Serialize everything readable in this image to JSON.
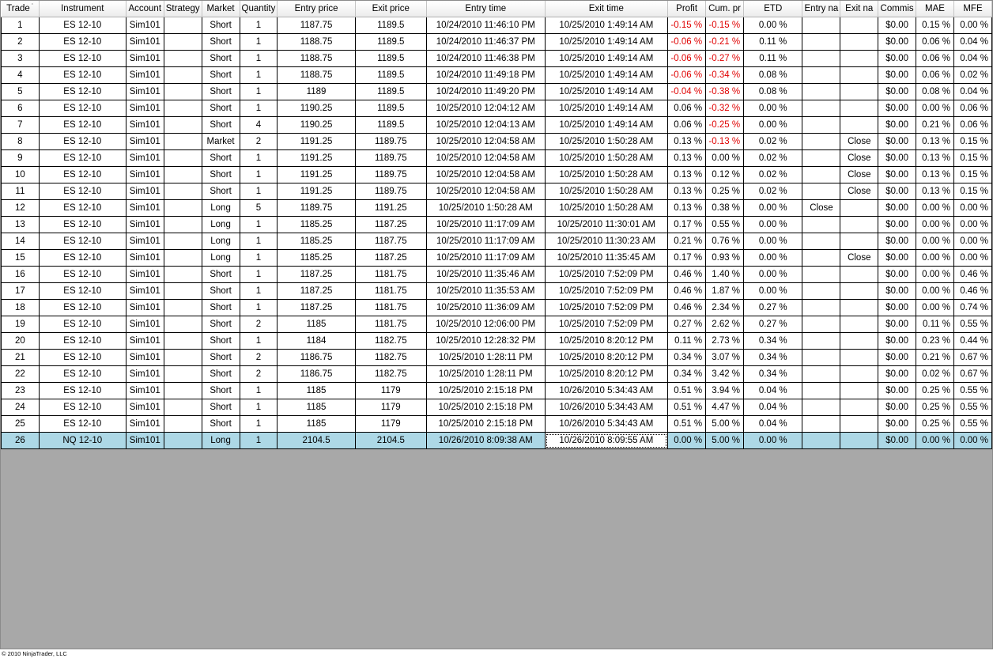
{
  "columns": [
    {
      "label": "Trade"
    },
    {
      "label": "Instrument"
    },
    {
      "label": "Account"
    },
    {
      "label": "Strategy"
    },
    {
      "label": "Market"
    },
    {
      "label": "Quantity"
    },
    {
      "label": "Entry price"
    },
    {
      "label": "Exit price"
    },
    {
      "label": "Entry time"
    },
    {
      "label": "Exit time"
    },
    {
      "label": "Profit"
    },
    {
      "label": "Cum. pr"
    },
    {
      "label": "ETD"
    },
    {
      "label": "Entry na"
    },
    {
      "label": "Exit na"
    },
    {
      "label": "Commis"
    },
    {
      "label": "MAE"
    },
    {
      "label": "MFE"
    }
  ],
  "sort_indicator": "ˆ",
  "rows": [
    [
      "1",
      "ES 12-10",
      "Sim101",
      "",
      "Short",
      "1",
      "1187.75",
      "1189.5",
      "10/24/2010 11:46:10 PM",
      "10/25/2010 1:49:14 AM",
      "-0.15 %",
      "-0.15 %",
      "0.00 %",
      "",
      "",
      "$0.00",
      "0.15 %",
      "0.00 %"
    ],
    [
      "2",
      "ES 12-10",
      "Sim101",
      "",
      "Short",
      "1",
      "1188.75",
      "1189.5",
      "10/24/2010 11:46:37 PM",
      "10/25/2010 1:49:14 AM",
      "-0.06 %",
      "-0.21 %",
      "0.11 %",
      "",
      "",
      "$0.00",
      "0.06 %",
      "0.04 %"
    ],
    [
      "3",
      "ES 12-10",
      "Sim101",
      "",
      "Short",
      "1",
      "1188.75",
      "1189.5",
      "10/24/2010 11:46:38 PM",
      "10/25/2010 1:49:14 AM",
      "-0.06 %",
      "-0.27 %",
      "0.11 %",
      "",
      "",
      "$0.00",
      "0.06 %",
      "0.04 %"
    ],
    [
      "4",
      "ES 12-10",
      "Sim101",
      "",
      "Short",
      "1",
      "1188.75",
      "1189.5",
      "10/24/2010 11:49:18 PM",
      "10/25/2010 1:49:14 AM",
      "-0.06 %",
      "-0.34 %",
      "0.08 %",
      "",
      "",
      "$0.00",
      "0.06 %",
      "0.02 %"
    ],
    [
      "5",
      "ES 12-10",
      "Sim101",
      "",
      "Short",
      "1",
      "1189",
      "1189.5",
      "10/24/2010 11:49:20 PM",
      "10/25/2010 1:49:14 AM",
      "-0.04 %",
      "-0.38 %",
      "0.08 %",
      "",
      "",
      "$0.00",
      "0.08 %",
      "0.04 %"
    ],
    [
      "6",
      "ES 12-10",
      "Sim101",
      "",
      "Short",
      "1",
      "1190.25",
      "1189.5",
      "10/25/2010 12:04:12 AM",
      "10/25/2010 1:49:14 AM",
      "0.06 %",
      "-0.32 %",
      "0.00 %",
      "",
      "",
      "$0.00",
      "0.00 %",
      "0.06 %"
    ],
    [
      "7",
      "ES 12-10",
      "Sim101",
      "",
      "Short",
      "4",
      "1190.25",
      "1189.5",
      "10/25/2010 12:04:13 AM",
      "10/25/2010 1:49:14 AM",
      "0.06 %",
      "-0.25 %",
      "0.00 %",
      "",
      "",
      "$0.00",
      "0.21 %",
      "0.06 %"
    ],
    [
      "8",
      "ES 12-10",
      "Sim101",
      "",
      "Market",
      "2",
      "1191.25",
      "1189.75",
      "10/25/2010 12:04:58 AM",
      "10/25/2010 1:50:28 AM",
      "0.13 %",
      "-0.13 %",
      "0.02 %",
      "",
      "Close",
      "$0.00",
      "0.13 %",
      "0.15 %"
    ],
    [
      "9",
      "ES 12-10",
      "Sim101",
      "",
      "Short",
      "1",
      "1191.25",
      "1189.75",
      "10/25/2010 12:04:58 AM",
      "10/25/2010 1:50:28 AM",
      "0.13 %",
      "0.00 %",
      "0.02 %",
      "",
      "Close",
      "$0.00",
      "0.13 %",
      "0.15 %"
    ],
    [
      "10",
      "ES 12-10",
      "Sim101",
      "",
      "Short",
      "1",
      "1191.25",
      "1189.75",
      "10/25/2010 12:04:58 AM",
      "10/25/2010 1:50:28 AM",
      "0.13 %",
      "0.12 %",
      "0.02 %",
      "",
      "Close",
      "$0.00",
      "0.13 %",
      "0.15 %"
    ],
    [
      "11",
      "ES 12-10",
      "Sim101",
      "",
      "Short",
      "1",
      "1191.25",
      "1189.75",
      "10/25/2010 12:04:58 AM",
      "10/25/2010 1:50:28 AM",
      "0.13 %",
      "0.25 %",
      "0.02 %",
      "",
      "Close",
      "$0.00",
      "0.13 %",
      "0.15 %"
    ],
    [
      "12",
      "ES 12-10",
      "Sim101",
      "",
      "Long",
      "5",
      "1189.75",
      "1191.25",
      "10/25/2010 1:50:28 AM",
      "10/25/2010 1:50:28 AM",
      "0.13 %",
      "0.38 %",
      "0.00 %",
      "Close",
      "",
      "$0.00",
      "0.00 %",
      "0.00 %"
    ],
    [
      "13",
      "ES 12-10",
      "Sim101",
      "",
      "Long",
      "1",
      "1185.25",
      "1187.25",
      "10/25/2010 11:17:09 AM",
      "10/25/2010 11:30:01 AM",
      "0.17 %",
      "0.55 %",
      "0.00 %",
      "",
      "",
      "$0.00",
      "0.00 %",
      "0.00 %"
    ],
    [
      "14",
      "ES 12-10",
      "Sim101",
      "",
      "Long",
      "1",
      "1185.25",
      "1187.75",
      "10/25/2010 11:17:09 AM",
      "10/25/2010 11:30:23 AM",
      "0.21 %",
      "0.76 %",
      "0.00 %",
      "",
      "",
      "$0.00",
      "0.00 %",
      "0.00 %"
    ],
    [
      "15",
      "ES 12-10",
      "Sim101",
      "",
      "Long",
      "1",
      "1185.25",
      "1187.25",
      "10/25/2010 11:17:09 AM",
      "10/25/2010 11:35:45 AM",
      "0.17 %",
      "0.93 %",
      "0.00 %",
      "",
      "Close",
      "$0.00",
      "0.00 %",
      "0.00 %"
    ],
    [
      "16",
      "ES 12-10",
      "Sim101",
      "",
      "Short",
      "1",
      "1187.25",
      "1181.75",
      "10/25/2010 11:35:46 AM",
      "10/25/2010 7:52:09 PM",
      "0.46 %",
      "1.40 %",
      "0.00 %",
      "",
      "",
      "$0.00",
      "0.00 %",
      "0.46 %"
    ],
    [
      "17",
      "ES 12-10",
      "Sim101",
      "",
      "Short",
      "1",
      "1187.25",
      "1181.75",
      "10/25/2010 11:35:53 AM",
      "10/25/2010 7:52:09 PM",
      "0.46 %",
      "1.87 %",
      "0.00 %",
      "",
      "",
      "$0.00",
      "0.00 %",
      "0.46 %"
    ],
    [
      "18",
      "ES 12-10",
      "Sim101",
      "",
      "Short",
      "1",
      "1187.25",
      "1181.75",
      "10/25/2010 11:36:09 AM",
      "10/25/2010 7:52:09 PM",
      "0.46 %",
      "2.34 %",
      "0.27 %",
      "",
      "",
      "$0.00",
      "0.00 %",
      "0.74 %"
    ],
    [
      "19",
      "ES 12-10",
      "Sim101",
      "",
      "Short",
      "2",
      "1185",
      "1181.75",
      "10/25/2010 12:06:00 PM",
      "10/25/2010 7:52:09 PM",
      "0.27 %",
      "2.62 %",
      "0.27 %",
      "",
      "",
      "$0.00",
      "0.11 %",
      "0.55 %"
    ],
    [
      "20",
      "ES 12-10",
      "Sim101",
      "",
      "Short",
      "1",
      "1184",
      "1182.75",
      "10/25/2010 12:28:32 PM",
      "10/25/2010 8:20:12 PM",
      "0.11 %",
      "2.73 %",
      "0.34 %",
      "",
      "",
      "$0.00",
      "0.23 %",
      "0.44 %"
    ],
    [
      "21",
      "ES 12-10",
      "Sim101",
      "",
      "Short",
      "2",
      "1186.75",
      "1182.75",
      "10/25/2010 1:28:11 PM",
      "10/25/2010 8:20:12 PM",
      "0.34 %",
      "3.07 %",
      "0.34 %",
      "",
      "",
      "$0.00",
      "0.21 %",
      "0.67 %"
    ],
    [
      "22",
      "ES 12-10",
      "Sim101",
      "",
      "Short",
      "2",
      "1186.75",
      "1182.75",
      "10/25/2010 1:28:11 PM",
      "10/25/2010 8:20:12 PM",
      "0.34 %",
      "3.42 %",
      "0.34 %",
      "",
      "",
      "$0.00",
      "0.02 %",
      "0.67 %"
    ],
    [
      "23",
      "ES 12-10",
      "Sim101",
      "",
      "Short",
      "1",
      "1185",
      "1179",
      "10/25/2010 2:15:18 PM",
      "10/26/2010 5:34:43 AM",
      "0.51 %",
      "3.94 %",
      "0.04 %",
      "",
      "",
      "$0.00",
      "0.25 %",
      "0.55 %"
    ],
    [
      "24",
      "ES 12-10",
      "Sim101",
      "",
      "Short",
      "1",
      "1185",
      "1179",
      "10/25/2010 2:15:18 PM",
      "10/26/2010 5:34:43 AM",
      "0.51 %",
      "4.47 %",
      "0.04 %",
      "",
      "",
      "$0.00",
      "0.25 %",
      "0.55 %"
    ],
    [
      "25",
      "ES 12-10",
      "Sim101",
      "",
      "Short",
      "1",
      "1185",
      "1179",
      "10/25/2010 2:15:18 PM",
      "10/26/2010 5:34:43 AM",
      "0.51 %",
      "5.00 %",
      "0.04 %",
      "",
      "",
      "$0.00",
      "0.25 %",
      "0.55 %"
    ],
    [
      "26",
      "NQ 12-10",
      "Sim101",
      "",
      "Long",
      "1",
      "2104.5",
      "2104.5",
      "10/26/2010 8:09:38 AM",
      "10/26/2010 8:09:55 AM",
      "0.00 %",
      "5.00 %",
      "0.00 %",
      "",
      "",
      "$0.00",
      "0.00 %",
      "0.00 %"
    ]
  ],
  "selected_row": "26",
  "footer": {
    "copyright": "© 2010 NinjaTrader, LLC"
  },
  "colors": {
    "negative": "#e00000",
    "selection": "#add8e6",
    "empty_area": "#a8a8a8"
  }
}
